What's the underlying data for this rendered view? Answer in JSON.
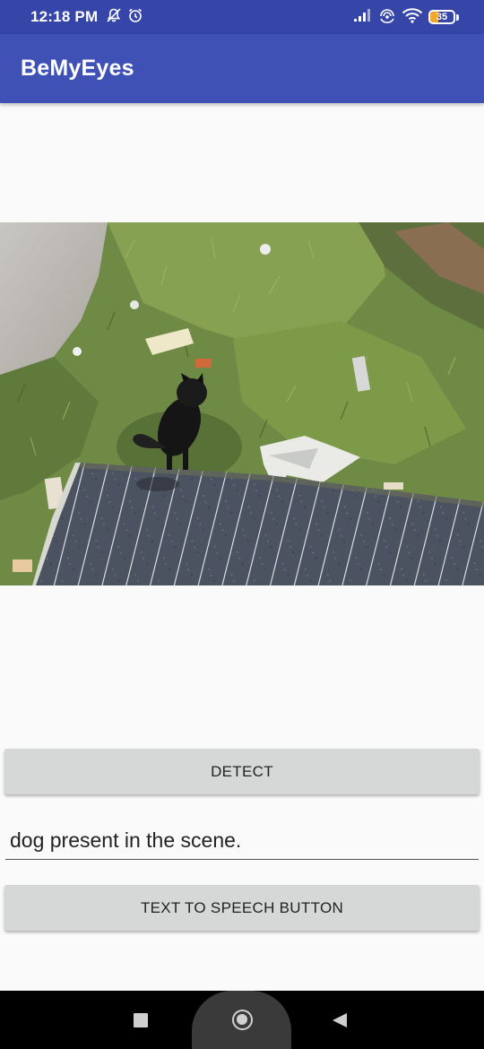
{
  "status_bar": {
    "time": "12:18 PM",
    "left_icons": [
      "bell-off-icon",
      "alarm-icon"
    ],
    "right_icons": [
      "signal-icon",
      "hotspot-icon",
      "wifi-icon"
    ],
    "battery_level": "35",
    "battery_fraction": 0.35,
    "battery_color": "#f0a830"
  },
  "app_bar": {
    "title": "BeMyEyes",
    "color": "#3f51b5"
  },
  "main": {
    "detect_label": "DETECT",
    "result_text": "dog present in the scene.",
    "tts_label": "TEXT TO SPEECH BUTTON"
  },
  "nav_bar": {
    "icons": [
      "recents-icon",
      "home-icon",
      "back-icon"
    ]
  }
}
